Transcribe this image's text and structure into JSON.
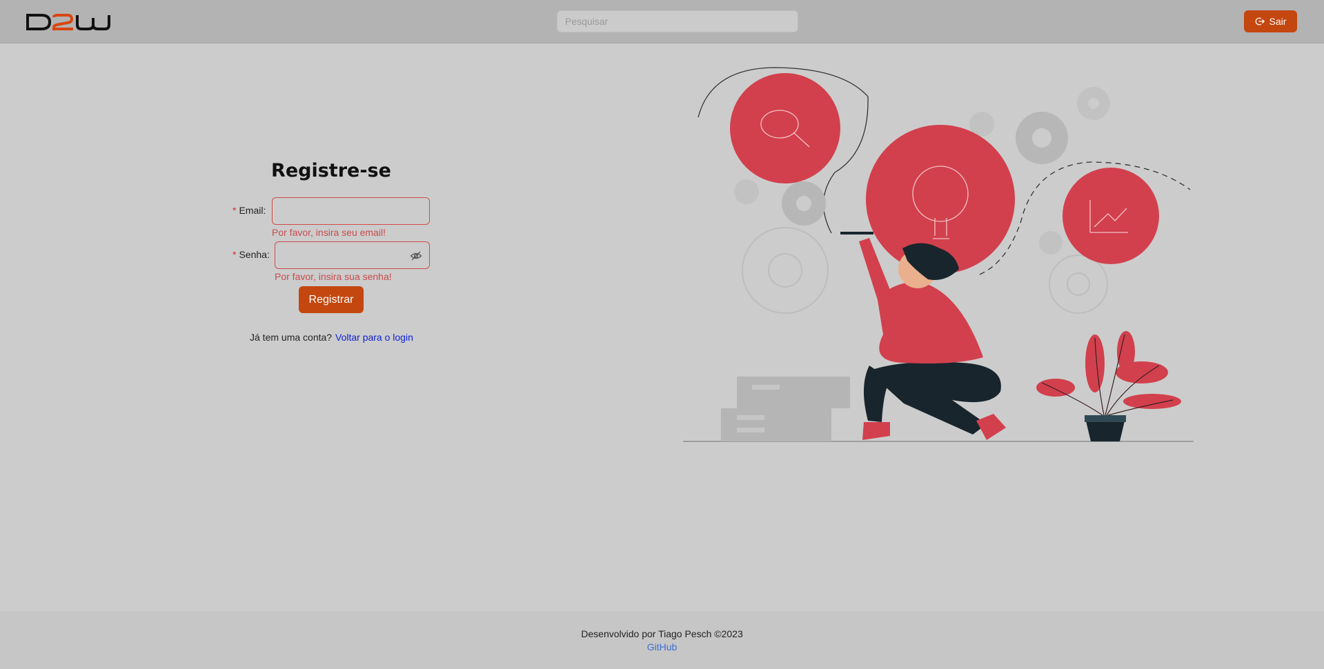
{
  "header": {
    "logo_text": "D2W",
    "search_placeholder": "Pesquisar",
    "logout_label": "Sair"
  },
  "form": {
    "title": "Registre-se",
    "email_label": "Email",
    "email_value": "",
    "email_error": "Por favor, insira seu email!",
    "password_label": "Senha",
    "password_value": "",
    "password_error": "Por favor, insira sua senha!",
    "submit_label": "Registrar",
    "have_account_text": "Já tem uma conta?",
    "back_to_login_label": "Voltar para o login",
    "required_marker": "*",
    "label_colon": ":"
  },
  "footer": {
    "credit": "Desenvolvido por Tiago Pesch ©2023",
    "github_label": "GitHub"
  },
  "colors": {
    "accent": "#c4470f",
    "error": "#d14a4a",
    "link": "#0d1fd6",
    "illustration_red": "#d2404d"
  },
  "icons": {
    "logout": "logout-icon",
    "password_toggle": "eye-invisible-icon",
    "logo": "d2w-logo"
  }
}
